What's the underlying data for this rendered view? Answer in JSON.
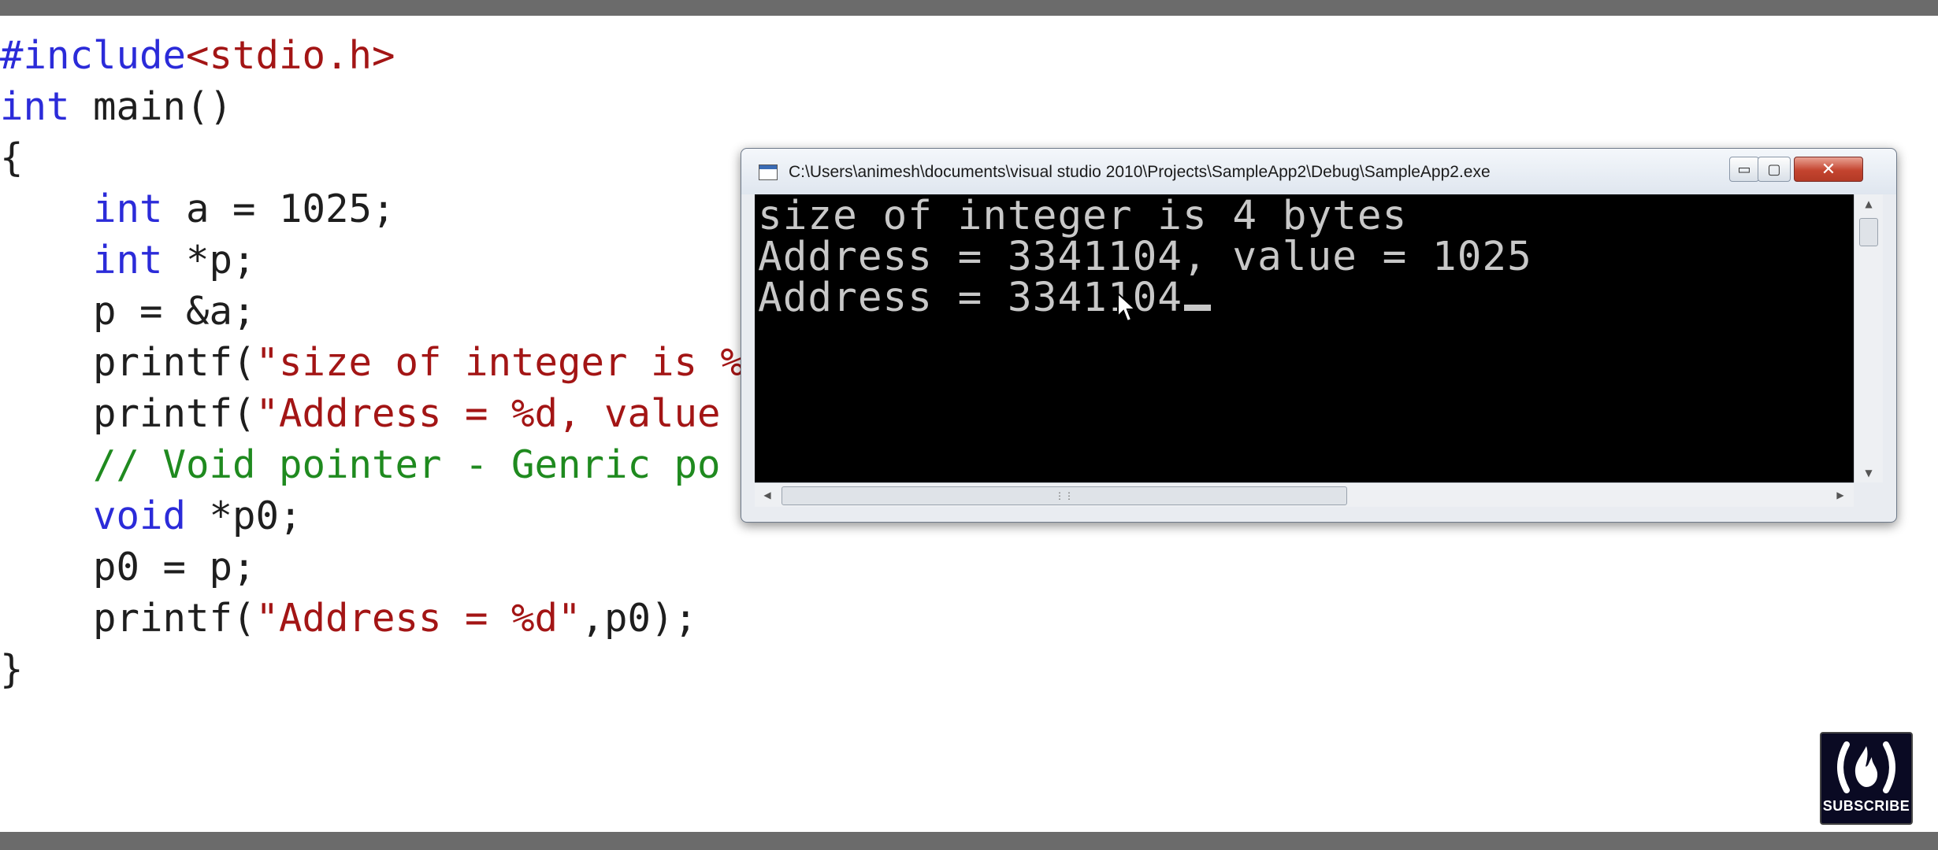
{
  "editor": {
    "lines": [
      {
        "segments": [
          {
            "text": "#include",
            "cls": "pp"
          },
          {
            "text": "<stdio.h>",
            "cls": "inc"
          }
        ]
      },
      {
        "segments": [
          {
            "text": "int",
            "cls": "kw"
          },
          {
            "text": " main()",
            "cls": ""
          }
        ]
      },
      {
        "segments": [
          {
            "text": "{",
            "cls": ""
          }
        ]
      },
      {
        "segments": [
          {
            "text": "    ",
            "cls": ""
          },
          {
            "text": "int",
            "cls": "kw"
          },
          {
            "text": " a = 1025;",
            "cls": ""
          }
        ]
      },
      {
        "segments": [
          {
            "text": "    ",
            "cls": ""
          },
          {
            "text": "int",
            "cls": "kw"
          },
          {
            "text": " *p;",
            "cls": ""
          }
        ]
      },
      {
        "segments": [
          {
            "text": "    p = &a;",
            "cls": ""
          }
        ]
      },
      {
        "segments": [
          {
            "text": "    printf(",
            "cls": ""
          },
          {
            "text": "\"size of integer is %",
            "cls": "str"
          }
        ]
      },
      {
        "segments": [
          {
            "text": "    printf(",
            "cls": ""
          },
          {
            "text": "\"Address = %d, value",
            "cls": "str"
          }
        ]
      },
      {
        "segments": [
          {
            "text": "    ",
            "cls": ""
          },
          {
            "text": "// Void pointer - Genric po",
            "cls": "cmt"
          }
        ]
      },
      {
        "segments": [
          {
            "text": "    ",
            "cls": ""
          },
          {
            "text": "void",
            "cls": "kw"
          },
          {
            "text": " *p0;",
            "cls": ""
          }
        ]
      },
      {
        "segments": [
          {
            "text": "    p0 = p;",
            "cls": ""
          }
        ]
      },
      {
        "segments": [
          {
            "text": "    printf(",
            "cls": ""
          },
          {
            "text": "\"Address = %d\"",
            "cls": "str"
          },
          {
            "text": ",p0);",
            "cls": ""
          }
        ]
      },
      {
        "segments": [
          {
            "text": "}",
            "cls": ""
          }
        ]
      }
    ]
  },
  "console": {
    "title": "C:\\Users\\animesh\\documents\\visual studio 2010\\Projects\\SampleApp2\\Debug\\SampleApp2.exe",
    "output": [
      "size of integer is 4 bytes",
      "Address = 3341104, value = 1025",
      "Address = 3341104"
    ],
    "minimize_glyph": "▭",
    "maximize_glyph": "▢",
    "close_glyph": "✕"
  },
  "badge": {
    "label": "SUBSCRIBE",
    "logo_glyph": "(🔥)",
    "icon": "freecodecamp-flame-icon"
  },
  "colors": {
    "keyword": "#2b2bd9",
    "string": "#a31515",
    "comment": "#1f8a1f",
    "console_bg": "#000000",
    "console_fg": "#c8c8c8"
  }
}
